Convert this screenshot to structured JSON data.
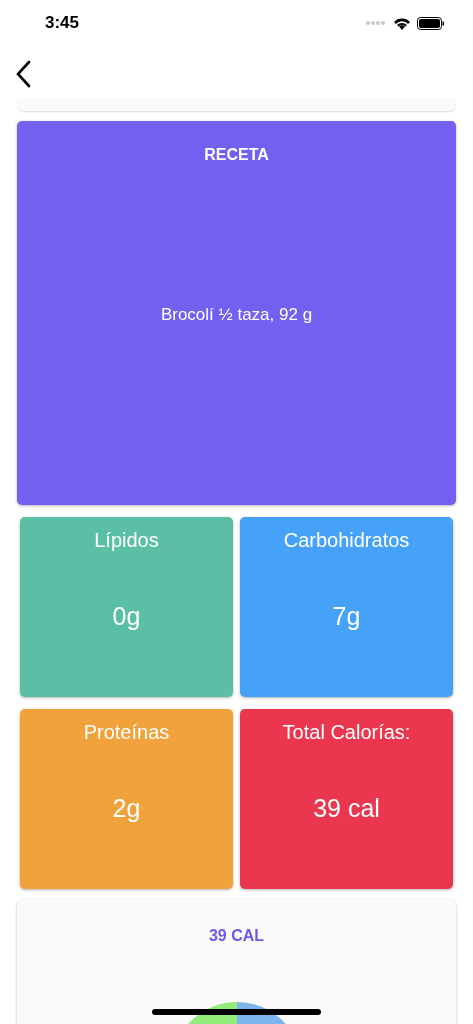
{
  "status_bar": {
    "time": "3:45"
  },
  "recipe": {
    "title": "RECETA",
    "ingredient": "Brocolí ½ taza, 92 g"
  },
  "nutrients": [
    {
      "label": "Lípidos",
      "value": "0g",
      "color": "#5bbfa6"
    },
    {
      "label": "Carbohidratos",
      "value": "7g",
      "color": "#46a1f8"
    },
    {
      "label": "Proteínas",
      "value": "2g",
      "color": "#f2a23a"
    },
    {
      "label": "Total Calorías:",
      "value": "39 cal",
      "color": "#ea374f"
    }
  ],
  "calories_card": {
    "title": "39 CAL"
  }
}
